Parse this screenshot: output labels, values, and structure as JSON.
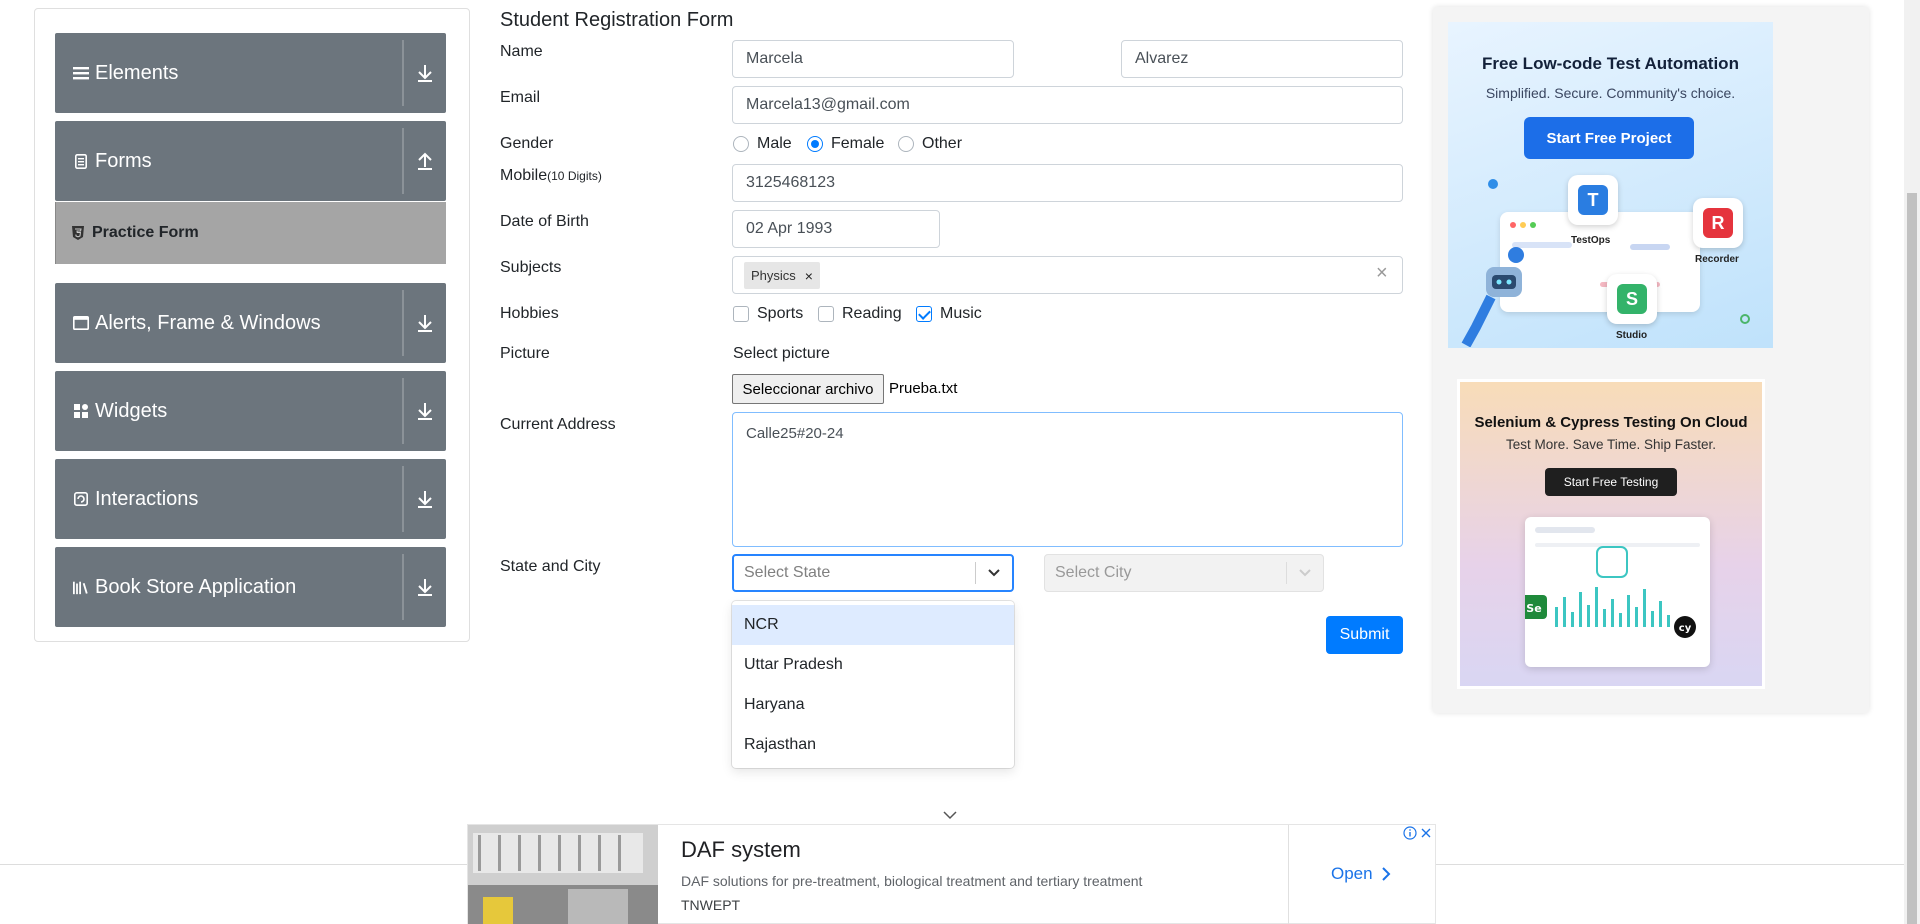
{
  "sidebar": {
    "groups": [
      {
        "label": "Elements",
        "icon": "hamburger-icon",
        "arrow": "download-icon"
      },
      {
        "label": "Forms",
        "icon": "document-icon",
        "arrow": "upload-icon"
      },
      {
        "label": "Alerts, Frame & Windows",
        "icon": "window-icon",
        "arrow": "download-icon"
      },
      {
        "label": "Widgets",
        "icon": "widgets-icon",
        "arrow": "download-icon"
      },
      {
        "label": "Interactions",
        "icon": "interactions-icon",
        "arrow": "download-icon"
      },
      {
        "label": "Book Store Application",
        "icon": "books-icon",
        "arrow": "download-icon"
      }
    ],
    "active_item": {
      "label": "Practice Form",
      "icon": "html5-icon"
    }
  },
  "form": {
    "title": "Student Registration Form",
    "labels": {
      "name": "Name",
      "email": "Email",
      "gender": "Gender",
      "mobile": "Mobile",
      "mobile_hint": "(10 Digits)",
      "dob": "Date of Birth",
      "subjects": "Subjects",
      "hobbies": "Hobbies",
      "picture": "Picture",
      "address": "Current Address",
      "state_city": "State and City"
    },
    "first_name": "Marcela",
    "last_name": "Alvarez",
    "email": "Marcela13@gmail.com",
    "gender_options": [
      {
        "label": "Male",
        "checked": false
      },
      {
        "label": "Female",
        "checked": true
      },
      {
        "label": "Other",
        "checked": false
      }
    ],
    "mobile": "3125468123",
    "dob": "02 Apr 1993",
    "subjects": [
      "Physics"
    ],
    "subject_remove": "×",
    "subjects_clear": "×",
    "hobbies": [
      {
        "label": "Sports",
        "checked": false
      },
      {
        "label": "Reading",
        "checked": false
      },
      {
        "label": "Music",
        "checked": true
      }
    ],
    "picture_label": "Select picture",
    "file_button": "Seleccionar archivo",
    "file_name": "Prueba.txt",
    "address": "Calle25#20-24",
    "state_placeholder": "Select State",
    "city_placeholder": "Select City",
    "state_options": [
      "NCR",
      "Uttar Pradesh",
      "Haryana",
      "Rajasthan"
    ],
    "highlighted_option": "NCR",
    "submit": "Submit"
  },
  "ads": {
    "ad1": {
      "title": "Free Low-code Test Automation",
      "subtitle": "Simplified. Secure. Community's choice.",
      "button": "Start Free Project",
      "tiles": [
        "TestOps",
        "Recorder",
        "Studio"
      ]
    },
    "ad2": {
      "title": "Selenium & Cypress Testing On Cloud",
      "subtitle": "Test More. Save Time. Ship Faster.",
      "button": "Start Free Testing"
    },
    "bottom": {
      "title": "DAF system",
      "description": "DAF solutions for pre-treatment, biological treatment and tertiary treatment",
      "brand": "TNWEPT",
      "cta": "Open"
    }
  },
  "colors": {
    "sidebar_group": "#6c757d",
    "active_item": "#a5a5a5",
    "primary": "#007bff",
    "option_highlight": "#deebff"
  }
}
